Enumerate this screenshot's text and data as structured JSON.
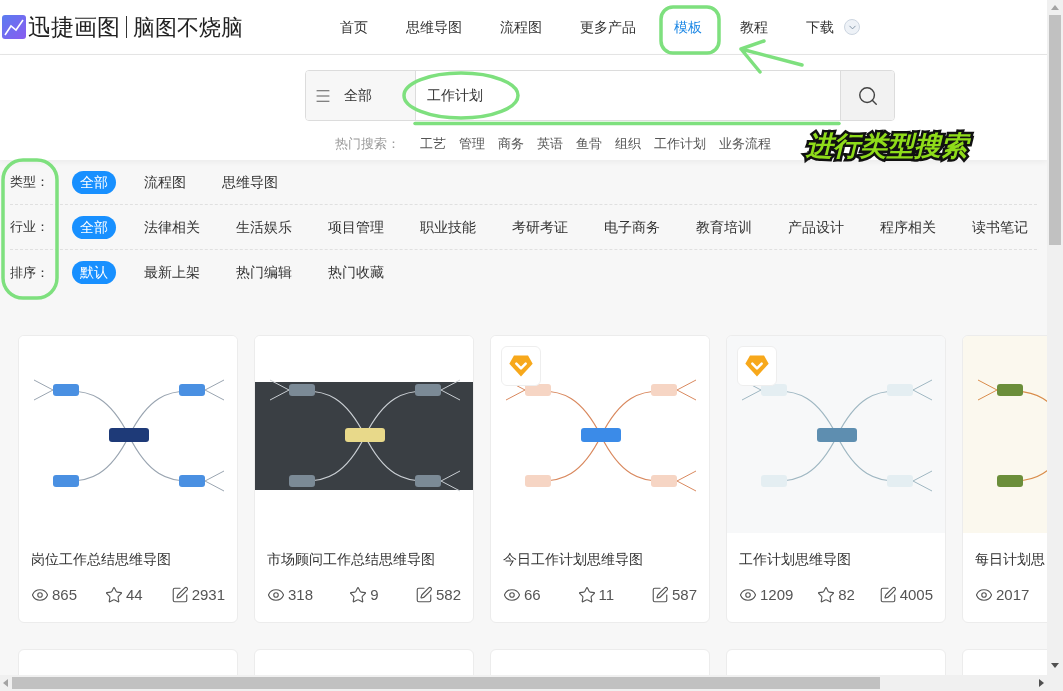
{
  "logo": {
    "brand": "迅捷画图",
    "slogan": "脑图不烧脑"
  },
  "nav": [
    {
      "label": "首页",
      "selected": false,
      "kind": "link"
    },
    {
      "label": "思维导图",
      "selected": false,
      "kind": "link"
    },
    {
      "label": "流程图",
      "selected": false,
      "kind": "link"
    },
    {
      "label": "更多产品",
      "selected": false,
      "kind": "link"
    },
    {
      "label": "模板",
      "selected": true,
      "kind": "link"
    },
    {
      "label": "教程",
      "selected": false,
      "kind": "link"
    },
    {
      "label": "下载",
      "selected": false,
      "kind": "dropdown"
    }
  ],
  "search": {
    "scope": "全部",
    "value": "工作计划",
    "hot_label": "热门搜索：",
    "hot_terms": [
      "工艺",
      "管理",
      "商务",
      "英语",
      "鱼骨",
      "组织",
      "工作计划",
      "业务流程"
    ]
  },
  "filters": [
    {
      "label": "类型：",
      "options": [
        {
          "label": "全部",
          "selected": true
        },
        {
          "label": "流程图",
          "selected": false
        },
        {
          "label": "思维导图",
          "selected": false
        }
      ]
    },
    {
      "label": "行业：",
      "options": [
        {
          "label": "全部",
          "selected": true
        },
        {
          "label": "法律相关",
          "selected": false
        },
        {
          "label": "生活娱乐",
          "selected": false
        },
        {
          "label": "项目管理",
          "selected": false
        },
        {
          "label": "职业技能",
          "selected": false
        },
        {
          "label": "考研考证",
          "selected": false
        },
        {
          "label": "电子商务",
          "selected": false
        },
        {
          "label": "教育培训",
          "selected": false
        },
        {
          "label": "产品设计",
          "selected": false
        },
        {
          "label": "程序相关",
          "selected": false
        },
        {
          "label": "读书笔记",
          "selected": false
        }
      ]
    },
    {
      "label": "排序：",
      "options": [
        {
          "label": "默认",
          "selected": true
        },
        {
          "label": "最新上架",
          "selected": false
        },
        {
          "label": "热门编辑",
          "selected": false
        },
        {
          "label": "热门收藏",
          "selected": false
        }
      ]
    }
  ],
  "cards": [
    {
      "title": "岗位工作总结思维导图",
      "views": "865",
      "stars": "44",
      "edits": "2931",
      "premium": false,
      "kind": "light"
    },
    {
      "title": "市场顾问工作总结思维导图",
      "views": "318",
      "stars": "9",
      "edits": "582",
      "premium": false,
      "kind": "dark"
    },
    {
      "title": "今日工作计划思维导图",
      "views": "66",
      "stars": "11",
      "edits": "587",
      "premium": true,
      "kind": "pastel"
    },
    {
      "title": "工作计划思维导图",
      "views": "1209",
      "stars": "82",
      "edits": "4005",
      "premium": true,
      "kind": "teal"
    },
    {
      "title": "每日计划思",
      "views": "2017",
      "premium": false,
      "kind": "warm"
    }
  ],
  "annotation": {
    "text": "进行类型搜索"
  }
}
